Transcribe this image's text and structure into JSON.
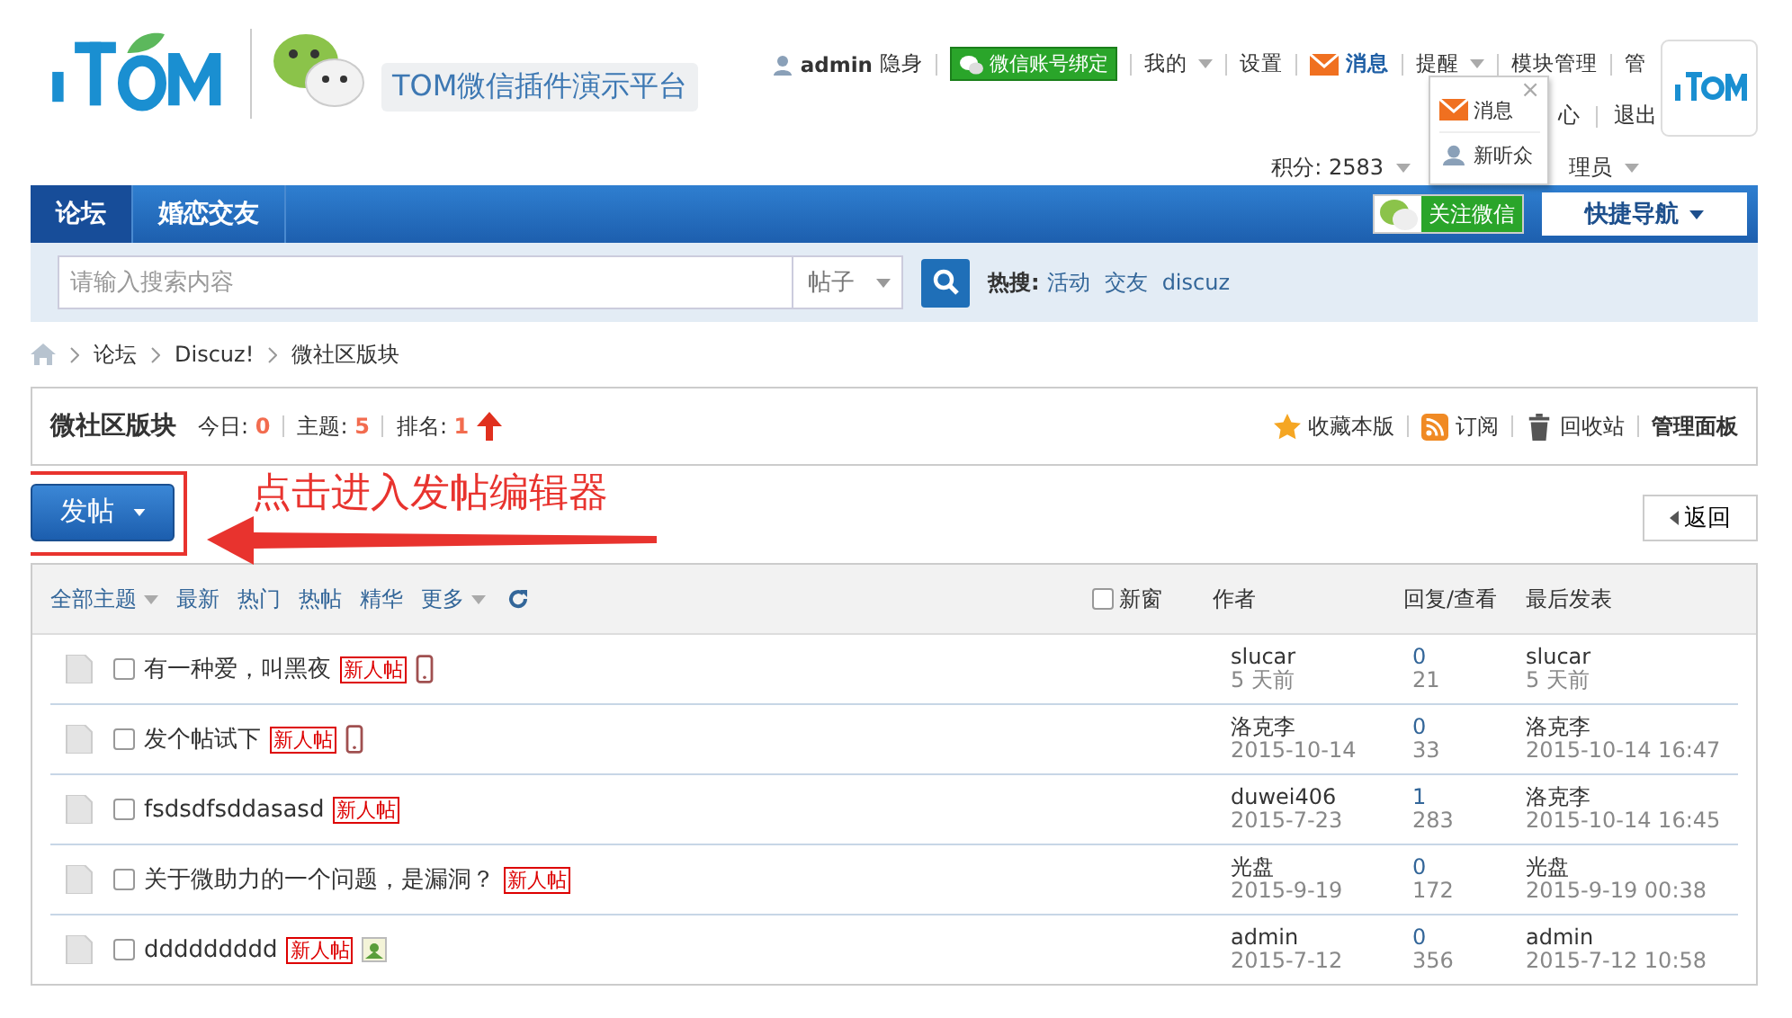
{
  "header": {
    "site_title": "TOM微信插件演示平台",
    "user": "admin",
    "status": "隐身",
    "wechat_bind": "微信账号绑定",
    "links": [
      {
        "label": "我的",
        "kind": "dropdown"
      },
      {
        "label": "设置",
        "kind": "link"
      },
      {
        "label": "消息",
        "kind": "message"
      },
      {
        "label": "提醒",
        "kind": "dropdown"
      },
      {
        "label": "模块管理",
        "kind": "link"
      },
      {
        "label": "管",
        "kind": "link"
      }
    ],
    "links_row2": [
      {
        "label": "心"
      },
      {
        "label": "退出"
      }
    ],
    "links_row3": [
      {
        "label": "积分: 2583",
        "kind": "dropdown"
      },
      {
        "label": "理员",
        "kind": "dropdown"
      }
    ]
  },
  "popup": {
    "close": "×",
    "items": [
      {
        "label": "消息",
        "kind": "mail"
      },
      {
        "label": "新听众",
        "kind": "user"
      }
    ]
  },
  "nav": {
    "tabs": [
      {
        "label": "论坛",
        "selected": true
      },
      {
        "label": "婚恋交友",
        "selected": false
      }
    ],
    "follow": "关注微信",
    "quick_nav": "快捷导航"
  },
  "search": {
    "placeholder": "请输入搜索内容",
    "type": "帖子",
    "hot_label": "热搜:",
    "hot": [
      "活动",
      "交友",
      "discuz"
    ]
  },
  "breadcrumb": [
    "论坛",
    "Discuz!",
    "微社区版块"
  ],
  "forum": {
    "name": "微社区版块",
    "stats": [
      {
        "label": "今日:",
        "value": "0"
      },
      {
        "label": "主题:",
        "value": "5"
      },
      {
        "label": "排名:",
        "value": "1"
      }
    ],
    "actions": [
      {
        "label": "收藏本版",
        "kind": "star"
      },
      {
        "label": "订阅",
        "kind": "rss"
      },
      {
        "label": "回收站",
        "kind": "trash"
      },
      {
        "label": "管理面板",
        "kind": "plain"
      }
    ]
  },
  "post_button": "发帖",
  "annotation": "点击进入发帖编辑器",
  "back": "返回",
  "filters": [
    {
      "label": "全部主题",
      "dropdown": true
    },
    {
      "label": "最新",
      "dropdown": false
    },
    {
      "label": "热门",
      "dropdown": false
    },
    {
      "label": "热帖",
      "dropdown": false
    },
    {
      "label": "精华",
      "dropdown": false
    },
    {
      "label": "更多",
      "dropdown": true
    }
  ],
  "new_window": {
    "label": "新窗",
    "checked": false
  },
  "columns": [
    "作者",
    "回复/查看",
    "最后发表"
  ],
  "threads": [
    {
      "title": "有一种爱，叫黑夜",
      "checked": false,
      "badge": "新人帖",
      "kind": "mobile",
      "author": "slucar",
      "date": "5 天前",
      "replies": "0",
      "views": "21",
      "last_user": "slucar",
      "last_time": "5 天前"
    },
    {
      "title": "发个帖试下",
      "checked": false,
      "badge": "新人帖",
      "kind": "mobile",
      "author": "洛克李",
      "date": "2015-10-14",
      "replies": "0",
      "views": "33",
      "last_user": "洛克李",
      "last_time": "2015-10-14 16:47"
    },
    {
      "title": "fsdsdfsddasasd",
      "checked": false,
      "badge": "新人帖",
      "kind": "plain",
      "author": "duwei406",
      "date": "2015-7-23",
      "replies": "1",
      "views": "283",
      "last_user": "洛克李",
      "last_time": "2015-10-14 16:45"
    },
    {
      "title": "关于微助力的一个问题，是漏洞？",
      "checked": false,
      "badge": "新人帖",
      "kind": "plain",
      "author": "光盘",
      "date": "2015-9-19",
      "replies": "0",
      "views": "172",
      "last_user": "光盘",
      "last_time": "2015-9-19 00:38"
    },
    {
      "title": "ddddddddd",
      "checked": false,
      "badge": "新人帖",
      "kind": "image",
      "author": "admin",
      "date": "2015-7-12",
      "replies": "0",
      "views": "356",
      "last_user": "admin",
      "last_time": "2015-7-12 10:58"
    }
  ]
}
